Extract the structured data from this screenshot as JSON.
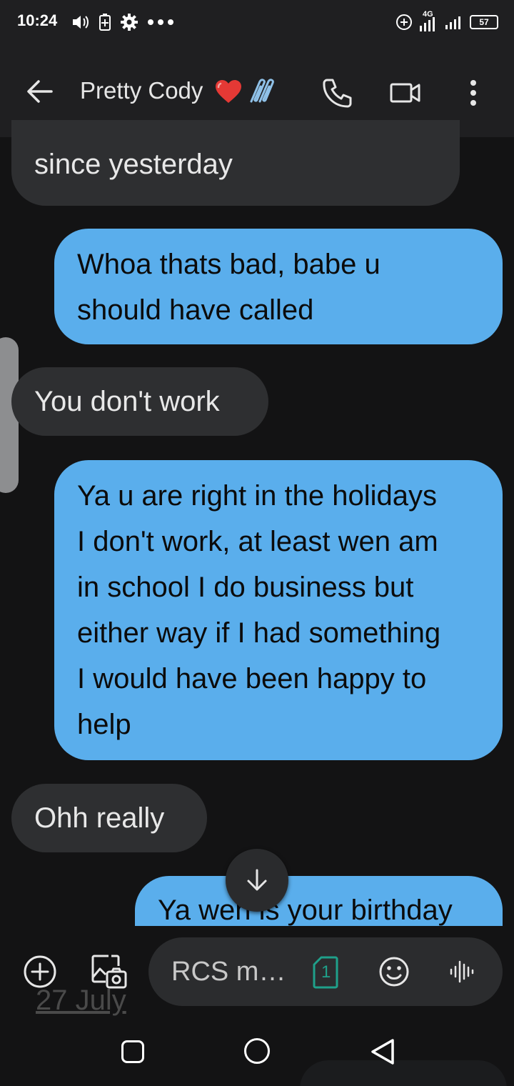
{
  "status_bar": {
    "time": "10:24",
    "network_label": "4G",
    "battery": "57"
  },
  "app_bar": {
    "contact_name": "Pretty Cody",
    "icons": [
      "back-arrow-icon",
      "red-heart-icon",
      "paperclip-icon",
      "phone-icon",
      "video-icon",
      "more-vert-icon"
    ]
  },
  "messages": [
    {
      "direction": "incoming",
      "text": "since yesterday"
    },
    {
      "direction": "outgoing",
      "text": "Whoa thats bad, babe u\nshould have called"
    },
    {
      "direction": "incoming",
      "text": "You don't work"
    },
    {
      "direction": "outgoing",
      "text": "Ya u are right in the holidays\nI don't work, at least wen am\nin school I do business but\neither way if I had something\nI would have been happy to\nhelp"
    },
    {
      "direction": "incoming",
      "text": "Ohh really"
    },
    {
      "direction": "outgoing",
      "text": "Ya wen is your birthday"
    }
  ],
  "compose": {
    "placeholder": "RCS m…",
    "sim_label": "1",
    "date_ghost": "27 July"
  },
  "colors": {
    "background": "#131314",
    "bar": "#1f1f21",
    "incoming_bubble": "#2e2f31",
    "outgoing_bubble": "#5aaeec",
    "heart": "#e53935",
    "sim_accent": "#1fa08a"
  }
}
